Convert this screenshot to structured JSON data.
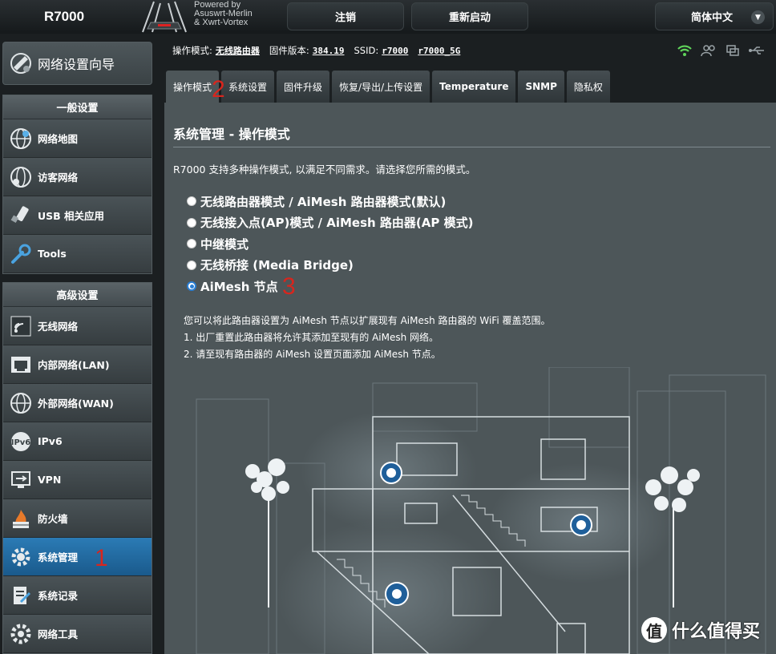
{
  "header": {
    "model": "R7000",
    "powered_by": [
      "Powered by",
      "Asuswrt-Merlin",
      "& Xwrt-Vortex"
    ],
    "logout": "注销",
    "reboot": "重新启动",
    "language": "简体中文"
  },
  "sidebar": {
    "quick_setup": "网络设置向导",
    "general_header": "一般设置",
    "general_items": [
      {
        "label": "网络地图",
        "icon": "globe-map-icon"
      },
      {
        "label": "访客网络",
        "icon": "guest-network-icon"
      },
      {
        "label": "USB 相关应用",
        "icon": "usb-icon"
      },
      {
        "label": "Tools",
        "icon": "wrench-icon"
      }
    ],
    "advanced_header": "高级设置",
    "advanced_items": [
      {
        "label": "无线网络",
        "icon": "wireless-icon"
      },
      {
        "label": "内部网络(LAN)",
        "icon": "lan-icon"
      },
      {
        "label": "外部网络(WAN)",
        "icon": "wan-globe-icon"
      },
      {
        "label": "IPv6",
        "icon": "ipv6-icon"
      },
      {
        "label": "VPN",
        "icon": "vpn-icon"
      },
      {
        "label": "防火墙",
        "icon": "firewall-icon"
      },
      {
        "label": "系统管理",
        "icon": "gear-icon",
        "active": true
      },
      {
        "label": "系统记录",
        "icon": "system-log-icon"
      },
      {
        "label": "网络工具",
        "icon": "network-tools-icon"
      }
    ]
  },
  "infobar": {
    "mode_label": "操作模式:",
    "mode_value": "无线路由器",
    "firmware_label": "固件版本:",
    "firmware_value": "384.19",
    "ssid_label": "SSID:",
    "ssid_1": "r7000",
    "ssid_2": "r7000_5G"
  },
  "tabs": [
    {
      "label": "操作模式",
      "active": true
    },
    {
      "label": "系统设置"
    },
    {
      "label": "固件升级"
    },
    {
      "label": "恢复/导出/上传设置"
    },
    {
      "label": "Temperature"
    },
    {
      "label": "SNMP"
    },
    {
      "label": "隐私权"
    }
  ],
  "content": {
    "title": "系统管理 - 操作模式",
    "intro": "R7000 支持多种操作模式, 以满足不同需求。请选择您所需的模式。",
    "modes": [
      {
        "label": "无线路由器模式 / AiMesh 路由器模式(默认)",
        "checked": false
      },
      {
        "label": "无线接入点(AP)模式 / AiMesh 路由器(AP 模式)",
        "checked": false
      },
      {
        "label": "中继模式",
        "checked": false
      },
      {
        "label": "无线桥接 (Media Bridge)",
        "checked": false
      },
      {
        "label": "AiMesh 节点",
        "checked": true
      }
    ],
    "desc": [
      "您可以将此路由器设置为 AiMesh 节点以扩展现有 AiMesh 路由器的 WiFi 覆盖范围。",
      "1. 出厂重置此路由器将允许其添加至现有的 AiMesh 网络。",
      "2. 请至现有路由器的 AiMesh 设置页面添加 AiMesh 节点。"
    ]
  },
  "annotations": {
    "one": "1",
    "two": "2",
    "three": "3"
  },
  "watermark": {
    "icon_char": "值",
    "text": "什么值得买"
  },
  "colors": {
    "accent_blue": "#2a7fd4",
    "active_menu": "#1a5a8c",
    "annotation_red": "#d7261e",
    "content_bg": "#4d5659"
  }
}
